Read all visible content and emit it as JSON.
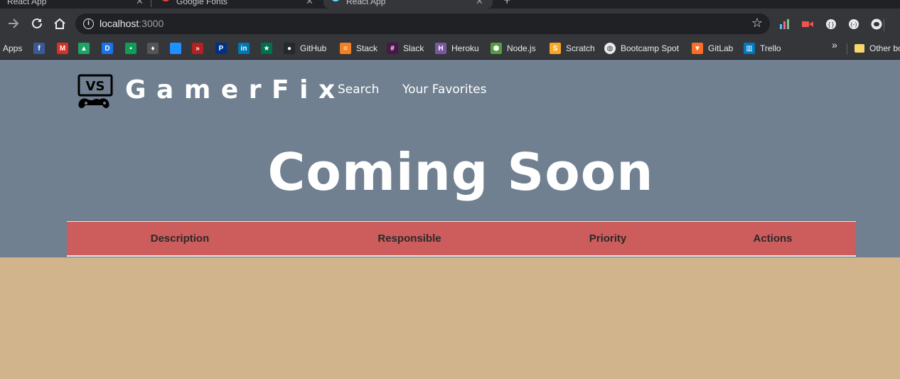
{
  "browser": {
    "tabs": [
      {
        "title": "React App"
      },
      {
        "title": "Google Fonts"
      },
      {
        "title": "React App"
      }
    ],
    "close_glyph": "✕",
    "new_tab_glyph": "+",
    "address": {
      "host": "localhost",
      "port": ":3000"
    },
    "bookmarks": [
      {
        "label": "Apps",
        "icon": "apps-grid-icon"
      },
      {
        "label": "",
        "icon": "facebook-icon",
        "color": "#3b5998",
        "glyph": "f"
      },
      {
        "label": "",
        "icon": "gmail-icon",
        "color": "#d93025",
        "glyph": "M"
      },
      {
        "label": "",
        "icon": "google-drive-icon",
        "color": "#1fa463",
        "glyph": "▲"
      },
      {
        "label": "",
        "icon": "dictionary-icon",
        "color": "#1a73e8",
        "glyph": "D"
      },
      {
        "label": "",
        "icon": "sheets-icon",
        "color": "#0f9d58",
        "glyph": "▪"
      },
      {
        "label": "",
        "icon": "bird-icon",
        "color": "#555555",
        "glyph": "♦"
      },
      {
        "label": "",
        "icon": "blue-square-icon",
        "color": "#1e90ff",
        "glyph": ""
      },
      {
        "label": "",
        "icon": "red-arrow-icon",
        "color": "#b22222",
        "glyph": "»"
      },
      {
        "label": "",
        "icon": "paypal-icon",
        "color": "#003087",
        "glyph": "P"
      },
      {
        "label": "",
        "icon": "linkedin-icon",
        "color": "#0077b5",
        "glyph": "in"
      },
      {
        "label": "",
        "icon": "starbucks-icon",
        "color": "#00704a",
        "glyph": "★"
      },
      {
        "label": "GitHub",
        "icon": "github-icon",
        "color": "#24292e",
        "glyph": "●"
      },
      {
        "label": "Stack",
        "icon": "stackoverflow-icon",
        "color": "#f48024",
        "glyph": "≡"
      },
      {
        "label": "Slack",
        "icon": "slack-icon",
        "color": "#4a154b",
        "glyph": "#"
      },
      {
        "label": "Heroku",
        "icon": "heroku-icon",
        "color": "#79589f",
        "glyph": "H"
      },
      {
        "label": "Node.js",
        "icon": "nodejs-icon",
        "color": "#539e43",
        "glyph": "⬢"
      },
      {
        "label": "Scratch",
        "icon": "scratch-icon",
        "color": "#f9a825",
        "glyph": "S"
      },
      {
        "label": "Bootcamp Spot",
        "icon": "globe-icon",
        "color": "#e8eaed",
        "glyph": "◍"
      },
      {
        "label": "GitLab",
        "icon": "gitlab-icon",
        "color": "#fc6d26",
        "glyph": "▼"
      },
      {
        "label": "Trello",
        "icon": "trello-icon",
        "color": "#0079bf",
        "glyph": "▥"
      }
    ],
    "more_glyph": "»",
    "other_bookmarks": "Other bo",
    "extensions": [
      "analytics-icon",
      "video-icon",
      "extension-icon-1",
      "extension-icon-2",
      "discord-icon"
    ],
    "colors": {
      "chrome_dark": "#202124",
      "chrome": "#35363a"
    }
  },
  "site": {
    "logo_text": "VS",
    "brand": "GamerFix",
    "nav": [
      "Search",
      "Your Favorites"
    ],
    "heading": "Coming Soon",
    "table": {
      "columns": [
        "Description",
        "Responsible",
        "Priority",
        "Actions"
      ]
    },
    "colors": {
      "hero": "#708090",
      "table_header": "#cd5c5c",
      "body": "#d2b48c"
    }
  }
}
